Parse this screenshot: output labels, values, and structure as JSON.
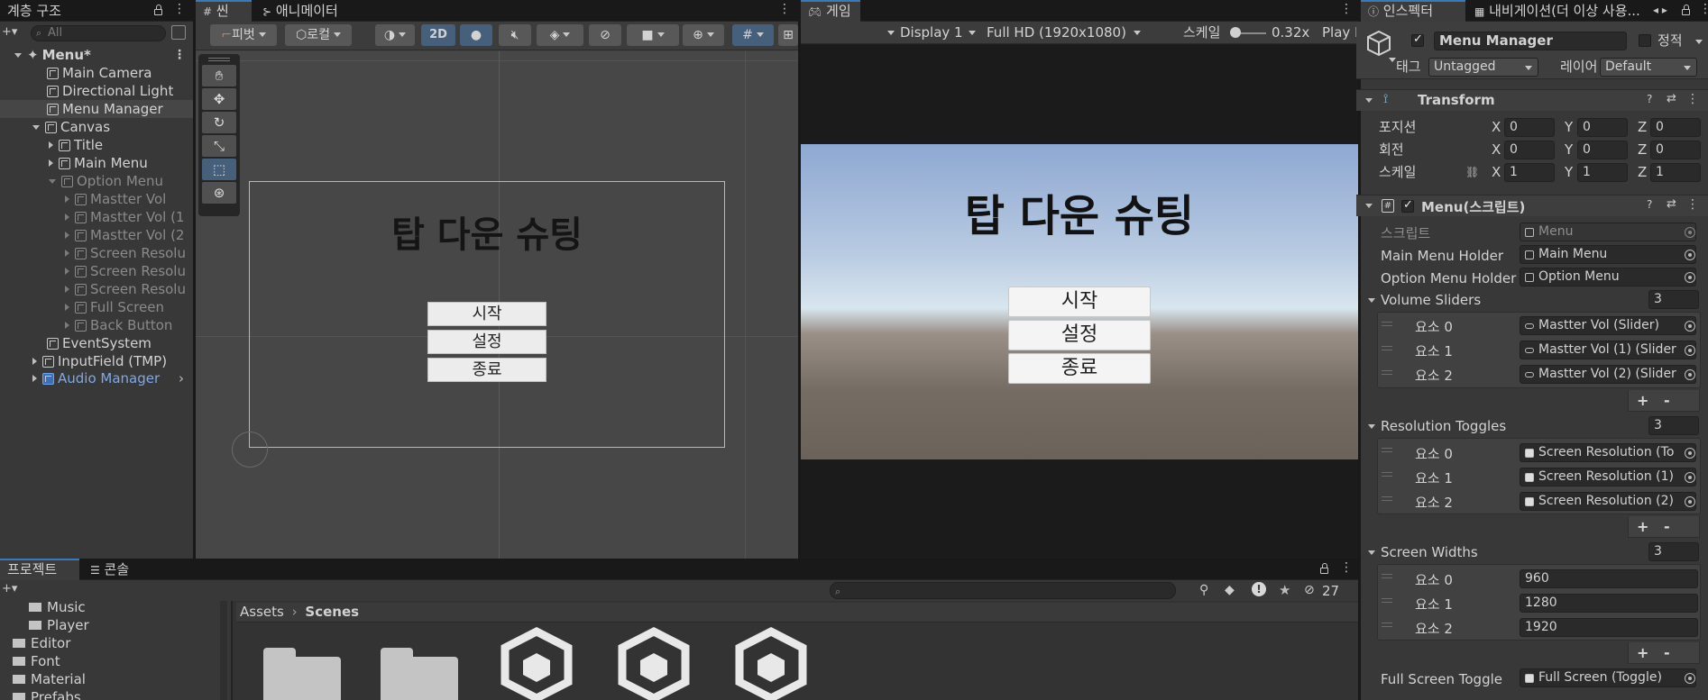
{
  "hierarchy": {
    "tab_label": "계층 구조",
    "search_placeholder": "All",
    "scene_name": "Menu*",
    "items": [
      {
        "label": "Main Camera"
      },
      {
        "label": "Directional Light"
      },
      {
        "label": "Menu Manager"
      },
      {
        "label": "Canvas"
      },
      {
        "label": "Title"
      },
      {
        "label": "Main Menu"
      },
      {
        "label": "Option Menu"
      },
      {
        "label": "Mastter Vol"
      },
      {
        "label": "Mastter Vol (1"
      },
      {
        "label": "Mastter Vol (2"
      },
      {
        "label": "Screen Resolu"
      },
      {
        "label": "Screen Resolu"
      },
      {
        "label": "Screen Resolu"
      },
      {
        "label": "Full Screen"
      },
      {
        "label": "Back Button"
      },
      {
        "label": "EventSystem"
      },
      {
        "label": "InputField (TMP)"
      },
      {
        "label": "Audio Manager"
      }
    ]
  },
  "scene_view": {
    "tabs": [
      {
        "label": "씬"
      },
      {
        "label": "애니메이터"
      }
    ],
    "toolbar": {
      "pivot": "피벗",
      "local": "로컬",
      "mode_2d": "2D"
    },
    "canvas": {
      "title": "탑 다운 슈팅",
      "buttons": [
        {
          "label": "시작"
        },
        {
          "label": "설정"
        },
        {
          "label": "종료"
        }
      ]
    }
  },
  "game_view": {
    "tab_label": "게임",
    "display": "Display 1",
    "resolution": "Full HD (1920x1080)",
    "scale_label": "스케일",
    "scale_value": "0.32x",
    "play_label": "Play I",
    "title": "탑 다운 슈팅",
    "buttons": [
      {
        "label": "시작"
      },
      {
        "label": "설정"
      },
      {
        "label": "종료"
      }
    ],
    "colors": {
      "sky_top": "#8ea8d2",
      "horizon": "#d8e6ef",
      "ground": "#6b625a"
    }
  },
  "inspector": {
    "tabs": [
      {
        "label": "인스펙터"
      },
      {
        "label": "내비게이션(더 이상 사용..."
      }
    ],
    "object_name": "Menu Manager",
    "static_label": "정적",
    "tag_label": "태그",
    "tag_value": "Untagged",
    "layer_label": "레이어",
    "layer_value": "Default",
    "transform": {
      "title": "Transform",
      "rows": [
        {
          "label": "포지션",
          "x": "0",
          "y": "0",
          "z": "0"
        },
        {
          "label": "회전",
          "x": "0",
          "y": "0",
          "z": "0"
        },
        {
          "label": "스케일",
          "x": "1",
          "y": "1",
          "z": "1"
        }
      ],
      "axis_x": "X",
      "axis_y": "Y",
      "axis_z": "Z"
    },
    "script_component": {
      "title": "Menu(스크립트)",
      "script_label": "스크립트",
      "script_value": "Menu",
      "main_menu_holder_label": "Main Menu Holder",
      "main_menu_holder_value": "Main Menu",
      "option_menu_holder_label": "Option Menu Holder",
      "option_menu_holder_value": "Option Menu",
      "volume_sliders": {
        "label": "Volume Sliders",
        "count": "3",
        "items": [
          {
            "label": "요소 0",
            "value": "Mastter Vol (Slider)"
          },
          {
            "label": "요소 1",
            "value": "Mastter Vol (1) (Slider"
          },
          {
            "label": "요소 2",
            "value": "Mastter Vol (2) (Slider"
          }
        ]
      },
      "resolution_toggles": {
        "label": "Resolution Toggles",
        "count": "3",
        "items": [
          {
            "label": "요소 0",
            "value": "Screen Resolution (To"
          },
          {
            "label": "요소 1",
            "value": "Screen Resolution (1)"
          },
          {
            "label": "요소 2",
            "value": "Screen Resolution (2)"
          }
        ]
      },
      "screen_widths": {
        "label": "Screen Widths",
        "count": "3",
        "items": [
          {
            "label": "요소 0",
            "value": "960"
          },
          {
            "label": "요소 1",
            "value": "1280"
          },
          {
            "label": "요소 2",
            "value": "1920"
          }
        ]
      },
      "full_screen_toggle_label": "Full Screen Toggle",
      "full_screen_toggle_value": "Full Screen (Toggle)",
      "plus": "+",
      "minus": "-"
    }
  },
  "project": {
    "tabs": [
      {
        "label": "프로젝트"
      },
      {
        "label": "콘솔"
      }
    ],
    "tree": [
      {
        "label": "Music"
      },
      {
        "label": "Player"
      },
      {
        "label": "Editor"
      },
      {
        "label": "Font"
      },
      {
        "label": "Material"
      },
      {
        "label": "Prefabs"
      }
    ],
    "breadcrumb_root": "Assets",
    "breadcrumb_current": "Scenes",
    "hidden_count": "27"
  }
}
